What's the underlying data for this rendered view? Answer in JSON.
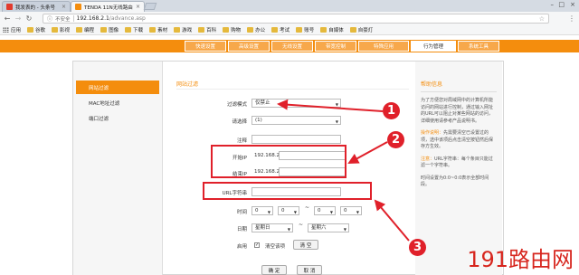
{
  "browser": {
    "tabs": [
      {
        "title": "我发表的 - 头条号",
        "active": false
      },
      {
        "title": "TENDA 11N无线路由器",
        "active": true
      }
    ],
    "address": {
      "security": "不安全",
      "host": "192.168.2.1",
      "path": "/advance.asp"
    },
    "bookmarks": [
      "应用",
      "谷歌",
      "影视",
      "编程",
      "图像",
      "下载",
      "素材",
      "游戏",
      "百科",
      "购物",
      "办公",
      "考试",
      "账号",
      "自媒体",
      "自豪灯"
    ]
  },
  "router_nav": {
    "tabs": [
      "快速设置",
      "高级设置",
      "无线设置",
      "带宽控制",
      "特殊应用",
      "行为管理",
      "系统工具"
    ],
    "active": "行为管理"
  },
  "sidebar": {
    "items": [
      "网站过滤",
      "MAC地址过滤",
      "端口过滤"
    ],
    "active": "网站过滤"
  },
  "form": {
    "section_title": "网站过滤",
    "mode_label": "过滤模式",
    "mode_value": "仅禁止",
    "select_label": "请选择",
    "select_value": "(1)",
    "note_label": "注释",
    "note_value": "",
    "start_ip_label": "开始IP",
    "start_ip_prefix": "192.168.2.",
    "end_ip_label": "结束IP",
    "end_ip_prefix": "192.168.2.",
    "url_label": "URL字符串",
    "url_value": "",
    "time_label": "时间",
    "time_values": [
      "0",
      "0",
      "0",
      "0"
    ],
    "tilde": "~",
    "date_label": "日期",
    "date_from": "星期日",
    "date_to": "星期六",
    "enable_label": "启用",
    "enable_checked": "✓",
    "clear_label": "清空该项",
    "clear_button": "清 空",
    "ok_button": "确 定",
    "cancel_button": "取 消"
  },
  "help": {
    "title": "帮助信息",
    "p1": "为了方便您对局域网中的计算机所能访问的网站进行控制，通过输入网址的URL可以阻止对某些网站的访问，详细使用请参考产品说明书。",
    "p2_key": "操作说明：",
    "p2": "先需要清空已设置过的项，选中该项后点击清空按钮然后保存方生效。",
    "p3_key": "注意：",
    "p3": "URL字符串：每个条目只能过滤一个字符串。",
    "p4": "时间设置为0:0~0:0表示全部时间段。"
  },
  "annotations": [
    "1",
    "2",
    "3"
  ],
  "watermark": "191路由网",
  "colors": {
    "accent": "#f48d0d",
    "annotation": "#e0202a"
  }
}
